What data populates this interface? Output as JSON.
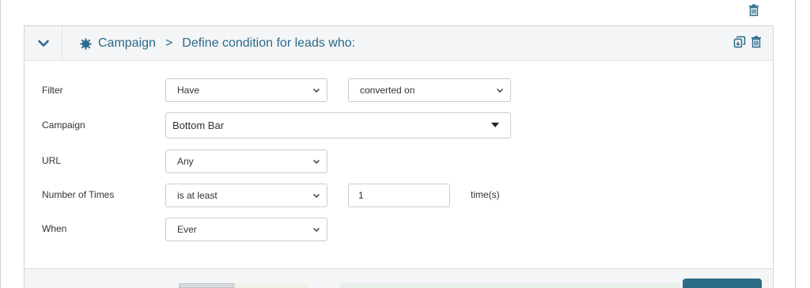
{
  "header": {
    "breadcrumb_root": "Campaign",
    "breadcrumb_separator": ">",
    "breadcrumb_current": "Define condition for leads who:"
  },
  "form": {
    "filter": {
      "label": "Filter",
      "operator": "Have",
      "action": "converted on"
    },
    "campaign": {
      "label": "Campaign",
      "value": "Bottom Bar"
    },
    "url": {
      "label": "URL",
      "value": "Any"
    },
    "number_of_times": {
      "label": "Number of Times",
      "operator": "is at least",
      "value": "1",
      "unit": "time(s)"
    },
    "when": {
      "label": "When",
      "value": "Ever"
    }
  },
  "icons": {
    "collapse": "chevron-down-icon",
    "campaign": "gear-badge-icon",
    "copy": "copy-icon",
    "delete": "trash-icon"
  },
  "colors": {
    "accent": "#2a6a8a",
    "header_bg": "#f4f5f6",
    "border": "#cfd3d6",
    "primary_button": "#2b6d86"
  }
}
